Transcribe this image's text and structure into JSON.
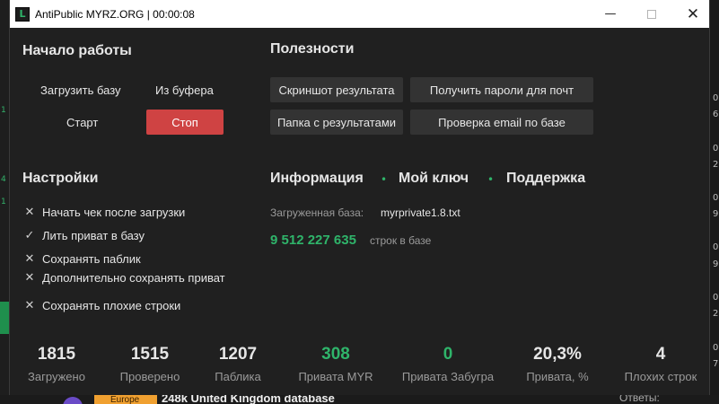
{
  "window": {
    "title": "AntiPublic MYRZ.ORG | 00:00:08",
    "icon_letter": "L"
  },
  "start": {
    "heading": "Начало работы",
    "load_base": "Загрузить базу",
    "from_clipboard": "Из буфера",
    "start": "Старт",
    "stop": "Стоп"
  },
  "utilities": {
    "heading": "Полезности",
    "screenshot": "Скриншот результата",
    "get_passwords": "Получить пароли для почт",
    "results_folder": "Папка с результатами",
    "check_email": "Проверка email по базе"
  },
  "settings": {
    "heading": "Настройки",
    "items": [
      {
        "mark": "✕",
        "label": "Начать чек после загрузки",
        "checked": false
      },
      {
        "mark": "✓",
        "label": "Лить приват в базу",
        "checked": true
      },
      {
        "mark": "✕",
        "label": "Сохранять паблик",
        "checked": false
      },
      {
        "mark": "✕",
        "label": "Дополнительно сохранять приват",
        "checked": false
      },
      {
        "mark": "✕",
        "label": "Сохранять плохие строки",
        "checked": false
      }
    ]
  },
  "info": {
    "tabs": [
      "Информация",
      "Мой ключ",
      "Поддержка"
    ],
    "separator": "•",
    "loaded_base_label": "Загруженная база:",
    "loaded_base_value": "myrprivate1.8.txt",
    "lines_count": "9 512 227 635",
    "lines_label": "строк в базе"
  },
  "stats": [
    {
      "value": "1815",
      "label": "Загружено",
      "accent": false
    },
    {
      "value": "1515",
      "label": "Проверено",
      "accent": false
    },
    {
      "value": "1207",
      "label": "Паблика",
      "accent": false
    },
    {
      "value": "308",
      "label": "Привата MYR",
      "accent": true
    },
    {
      "value": "0",
      "label": "Привата Забугра",
      "accent": true
    },
    {
      "value": "20,3%",
      "label": "Привата, %",
      "accent": false
    },
    {
      "value": "4",
      "label": "Плохих строк",
      "accent": false
    }
  ],
  "background": {
    "right_numbers": [
      "0",
      "6",
      "0",
      "2",
      "0",
      "9",
      "0",
      "9",
      "0",
      "2",
      "0",
      "7"
    ],
    "left_numbers": [
      "1",
      "4",
      "1"
    ],
    "tag": "Europe",
    "thread_title": "248k United Kingdom database",
    "replies_label": "Ответы:"
  },
  "colors": {
    "accent_green": "#2fb46a",
    "stop_red": "#cf4343",
    "window_bg": "#202020",
    "button_bg": "#333333"
  }
}
